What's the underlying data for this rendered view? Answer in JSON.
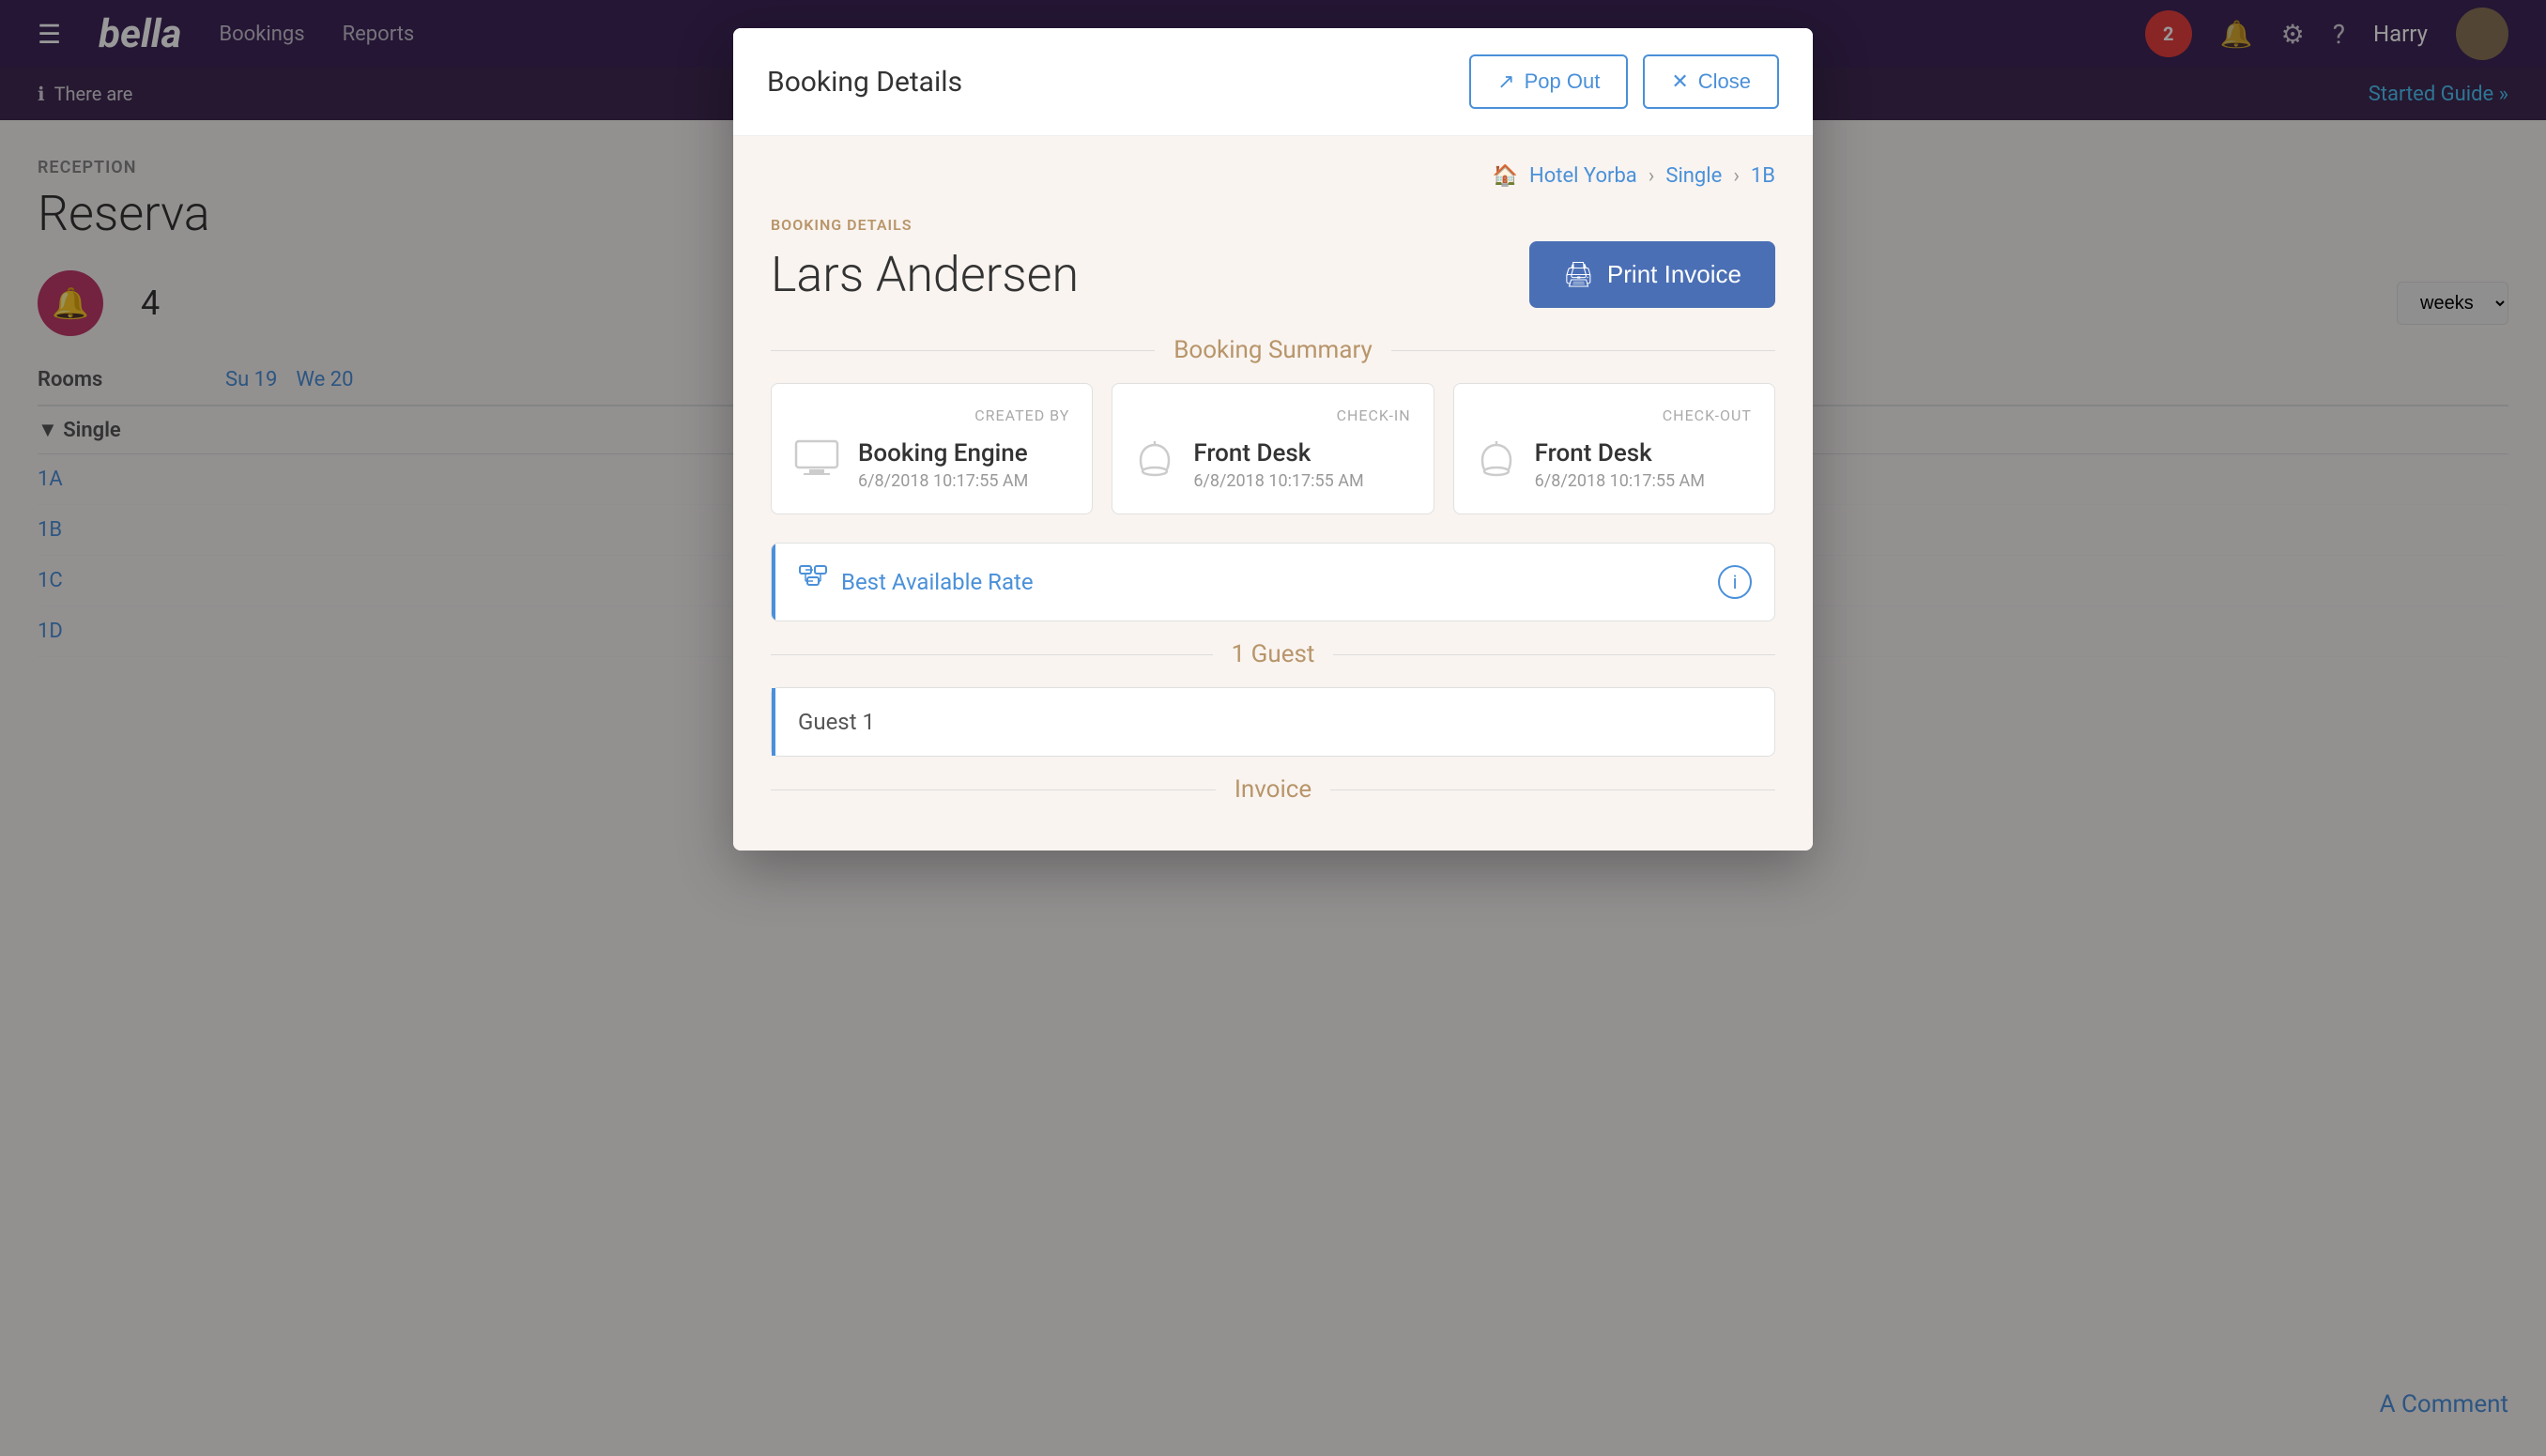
{
  "app": {
    "logo": "bella",
    "hamburger": "☰",
    "nav_items": [
      "Bookings",
      "Reports"
    ],
    "notification_count": "2",
    "user_name": "Harry",
    "top_icons": [
      "🔔",
      "⚙",
      "?"
    ]
  },
  "sub_bar": {
    "info_text": "There are",
    "started_guide": "Started Guide »"
  },
  "main": {
    "reception_label": "RECEPTION",
    "page_title": "Reserva",
    "bell_count": "4",
    "rooms_label": "Rooms",
    "single_label": "▼ Single",
    "room_rows": [
      "1A",
      "1B",
      "1C",
      "1D"
    ],
    "col_headers": [
      "Su 19",
      "We 20"
    ],
    "weeks_option": "weeks"
  },
  "comment": {
    "text": "A Comment"
  },
  "modal": {
    "title": "Booking Details",
    "pop_out_label": "Pop Out",
    "close_label": "Close",
    "breadcrumb": {
      "home_icon": "🏠",
      "hotel": "Hotel Yorba",
      "separator1": "›",
      "room_type": "Single",
      "separator2": "›",
      "room": "1B"
    },
    "booking_details_label": "BOOKING DETAILS",
    "guest_name": "Lars Andersen",
    "print_invoice_label": "Print Invoice",
    "booking_summary_title": "Booking Summary",
    "cards": [
      {
        "header": "CREATED BY",
        "main_text": "Booking Engine",
        "sub_text": "6/8/2018 10:17:55 AM",
        "icon": "🖥"
      },
      {
        "header": "CHECK-IN",
        "main_text": "Front Desk",
        "sub_text": "6/8/2018 10:17:55 AM",
        "icon": "🔔"
      },
      {
        "header": "CHECK-OUT",
        "main_text": "Front Desk",
        "sub_text": "6/8/2018 10:17:55 AM",
        "icon": "🔔"
      }
    ],
    "rate_name": "Best Available Rate",
    "rate_icon": "⊞",
    "info_label": "i",
    "guest_section_title": "1 Guest",
    "guest_label": "Guest 1",
    "invoice_title": "Invoice"
  }
}
